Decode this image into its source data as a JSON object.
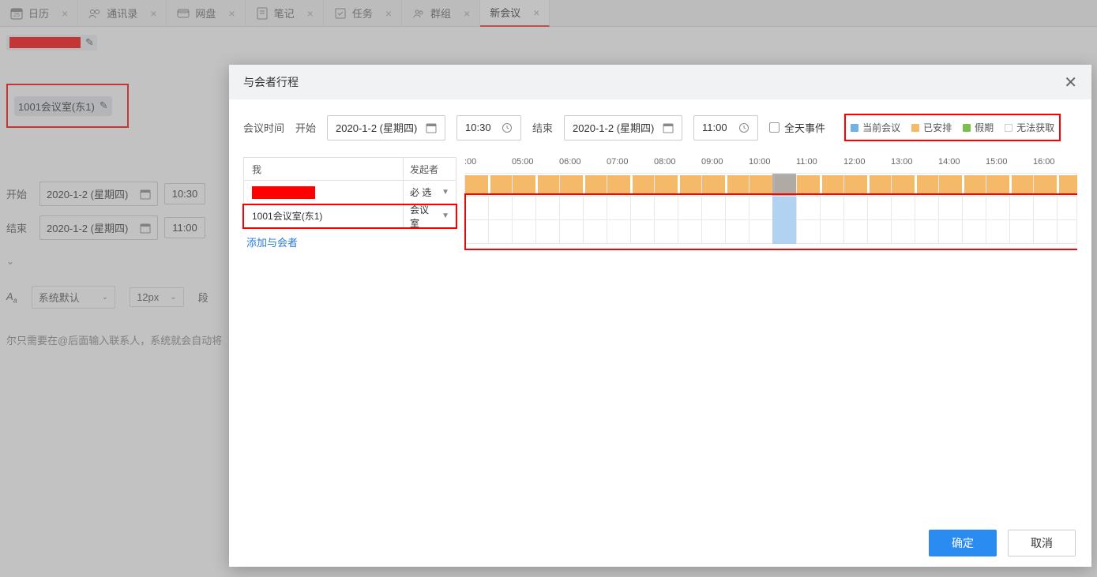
{
  "tabs": [
    {
      "icon": "calendar",
      "label": "日历"
    },
    {
      "icon": "contacts",
      "label": "通讯录"
    },
    {
      "icon": "drive",
      "label": "网盘"
    },
    {
      "icon": "notes",
      "label": "笔记"
    },
    {
      "icon": "tasks",
      "label": "任务"
    },
    {
      "icon": "group",
      "label": "群组"
    },
    {
      "icon": "",
      "label": "新会议",
      "active": true
    }
  ],
  "bg": {
    "room_label": "1001会议室(东1)",
    "start_label": "开始",
    "start_date": "2020-1-2 (星期四)",
    "start_time": "10:30",
    "end_label": "结束",
    "end_date": "2020-1-2 (星期四)",
    "end_time": "11:00",
    "font_label": "系统默认",
    "size_label": "12px",
    "para_label": "段",
    "hint": "尔只需要在@后面输入联系人，系统就会自动将"
  },
  "modal": {
    "title": "与会者行程",
    "meeting_time_label": "会议时间",
    "start_label": "开始",
    "start_date": "2020-1-2 (星期四)",
    "start_time": "10:30",
    "end_label": "结束",
    "end_date": "2020-1-2 (星期四)",
    "end_time": "11:00",
    "allday_label": "全天事件",
    "legend": {
      "current": "当前会议",
      "scheduled": "已安排",
      "holiday": "假期",
      "unavail": "无法获取"
    },
    "colors": {
      "current": "#6fb1e8",
      "scheduled": "#f5b96a",
      "holiday": "#7bc04b",
      "unavail": "#e8e8e8"
    },
    "col_me": "我",
    "col_role": "发起者",
    "row2_role": "必 选",
    "row3_name": "1001会议室(东1)",
    "row3_role": "会议室",
    "add_attendee": "添加与会者",
    "hours": [
      ":00",
      "05:00",
      "06:00",
      "07:00",
      "08:00",
      "09:00",
      "10:00",
      "11:00",
      "12:00",
      "13:00",
      "14:00",
      "15:00",
      "16:00"
    ],
    "ok": "确定",
    "cancel": "取消"
  }
}
